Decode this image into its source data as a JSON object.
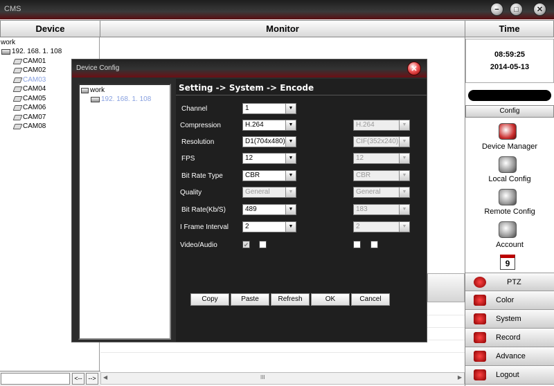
{
  "app": {
    "title": "CMS"
  },
  "window_buttons": {
    "min": "−",
    "restore": "□",
    "close": "✕"
  },
  "headers": {
    "device": "Device",
    "monitor": "Monitor",
    "time": "Time"
  },
  "device_tree": {
    "root": "work",
    "device": "192. 168. 1. 108",
    "cameras": [
      "CAM01",
      "CAM02",
      "CAM03",
      "CAM04",
      "CAM05",
      "CAM06",
      "CAM07",
      "CAM08"
    ],
    "selected_index": 2
  },
  "clock": {
    "time": "08:59:25",
    "date": "2014-05-13"
  },
  "right_panel": {
    "config_tab": "Config",
    "items": [
      {
        "label": "Device Manager",
        "icon": "device-manager-icon"
      },
      {
        "label": "Local Config",
        "icon": "local-config-icon"
      },
      {
        "label": "Remote Config",
        "icon": "remote-config-icon"
      },
      {
        "label": "Account",
        "icon": "account-icon"
      }
    ],
    "calendar_day": "9",
    "buttons": [
      "PTZ",
      "Color",
      "System",
      "Record",
      "Advance",
      "Logout"
    ]
  },
  "dialog": {
    "title": "Device Config",
    "close": "✕",
    "tree_root": "work",
    "tree_device": "192. 168. 1. 108",
    "breadcrumb": "Setting -> System -> Encode",
    "fields": [
      {
        "label": "Channel",
        "main": "1",
        "extra": null
      },
      {
        "label": "Compression",
        "main": "H.264",
        "extra": "H.264"
      },
      {
        "label": "Resolution",
        "main": "D1(704x480)",
        "extra": "CIF(352x240)"
      },
      {
        "label": "FPS",
        "main": "12",
        "extra": "12"
      },
      {
        "label": "Bit Rate Type",
        "main": "CBR",
        "extra": "CBR"
      },
      {
        "label": "Quality",
        "main": "General",
        "extra": "General"
      },
      {
        "label": "Bit Rate(Kb/S)",
        "main": "489",
        "extra": "183"
      },
      {
        "label": "I Frame Interval",
        "main": "2",
        "extra": "2"
      }
    ],
    "video_audio_label": "Video/Audio",
    "checkbox_mark": "✔",
    "buttons": {
      "copy": "Copy",
      "paste": "Paste",
      "refresh": "Refresh",
      "ok": "OK",
      "cancel": "Cancel"
    }
  },
  "bottom": {
    "prev": "<--",
    "next": "-->",
    "scroll_left": "◀",
    "scroll_right": "▶",
    "scroll_grip": "III"
  }
}
